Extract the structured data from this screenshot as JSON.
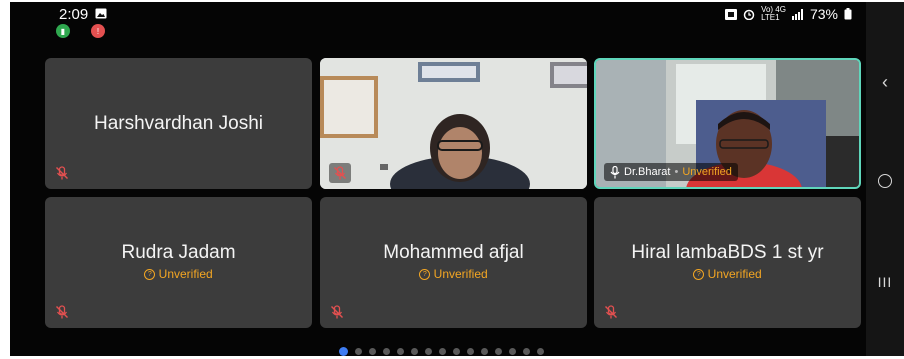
{
  "status": {
    "time": "2:09",
    "battery": "73%",
    "network_text": "Vo) 4G\nLTE1",
    "colors": {
      "app1": "#2fa84f",
      "app2": "#e35050"
    }
  },
  "participants": [
    {
      "name": "Harshvardhan Joshi",
      "unverified": "",
      "muted": true,
      "video": false
    },
    {
      "name": "",
      "unverified": "",
      "muted": true,
      "video": true
    },
    {
      "name": "Dr.Bharat",
      "unverified": "Unverified",
      "muted": false,
      "video": true,
      "active_speaker": true
    },
    {
      "name": "Rudra Jadam",
      "unverified": "Unverified",
      "muted": true,
      "video": false
    },
    {
      "name": "Mohammed afjal",
      "unverified": "Unverified",
      "muted": true,
      "video": false
    },
    {
      "name": "Hiral lambaBDS 1 st yr",
      "unverified": "Unverified",
      "muted": true,
      "video": false
    }
  ],
  "pager": {
    "total": 15,
    "current": 1
  },
  "colors": {
    "tile_bg": "#3c3c3c",
    "speaker_border": "#5fd6bb",
    "unverified": "#f3a623",
    "active_dot": "#3e7df3"
  }
}
